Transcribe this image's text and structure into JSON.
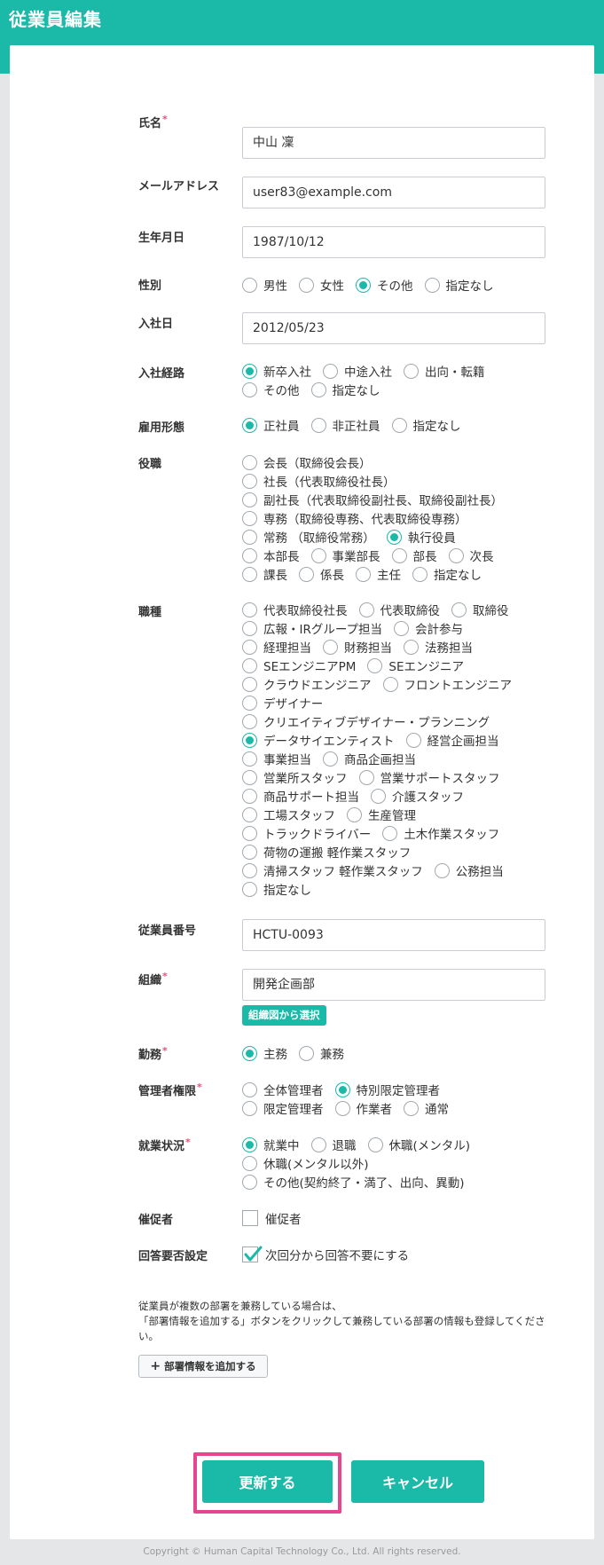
{
  "page_title": "従業員編集",
  "fields": {
    "name": {
      "label": "氏名",
      "value": "中山 凜"
    },
    "email": {
      "label": "メールアドレス",
      "value": "user83@example.com"
    },
    "birthdate": {
      "label": "生年月日",
      "value": "1987/10/12"
    },
    "gender": {
      "label": "性別",
      "options": [
        "男性",
        "女性",
        "その他",
        "指定なし"
      ],
      "selected": "その他"
    },
    "join_date": {
      "label": "入社日",
      "value": "2012/05/23"
    },
    "join_route": {
      "label": "入社経路",
      "options": [
        "新卒入社",
        "中途入社",
        "出向・転籍",
        "その他",
        "指定なし"
      ],
      "selected": "新卒入社"
    },
    "employment_type": {
      "label": "雇用形態",
      "options": [
        "正社員",
        "非正社員",
        "指定なし"
      ],
      "selected": "正社員"
    },
    "position": {
      "label": "役職",
      "options": [
        "会長（取締役会長）",
        "社長（代表取締役社長）",
        "副社長（代表取締役副社長、取締役副社長）",
        "専務（取締役専務、代表取締役専務）",
        "常務 （取締役常務）",
        "執行役員",
        "本部長",
        "事業部長",
        "部長",
        "次長",
        "課長",
        "係長",
        "主任",
        "指定なし"
      ],
      "selected": "執行役員"
    },
    "job_type": {
      "label": "職種",
      "options": [
        "代表取締役社長",
        "代表取締役",
        "取締役",
        "広報・IRグループ担当",
        "会計参与",
        "経理担当",
        "財務担当",
        "法務担当",
        "SEエンジニアPM",
        "SEエンジニア",
        "クラウドエンジニア",
        "フロントエンジニア",
        "デザイナー",
        "クリエイティブデザイナー・プランニング",
        "データサイエンティスト",
        "経営企画担当",
        "事業担当",
        "商品企画担当",
        "営業所スタッフ",
        "営業サポートスタッフ",
        "商品サポート担当",
        "介護スタッフ",
        "工場スタッフ",
        "生産管理",
        "トラックドライバー",
        "土木作業スタッフ",
        "荷物の運搬 軽作業スタッフ",
        "清掃スタッフ 軽作業スタッフ",
        "公務担当",
        "指定なし"
      ],
      "selected": "データサイエンティスト"
    },
    "employee_number": {
      "label": "従業員番号",
      "value": "HCTU-0093"
    },
    "organization": {
      "label": "組織",
      "value": "開発企画部",
      "button_label": "組織図から選択"
    },
    "work_type": {
      "label": "勤務",
      "options": [
        "主務",
        "兼務"
      ],
      "selected": "主務"
    },
    "admin_role": {
      "label": "管理者権限",
      "options": [
        "全体管理者",
        "特別限定管理者",
        "限定管理者",
        "作業者",
        "通常"
      ],
      "selected": "特別限定管理者"
    },
    "work_status": {
      "label": "就業状況",
      "options": [
        "就業中",
        "退職",
        "休職(メンタル)",
        "休職(メンタル以外)",
        "その他(契約終了・満了、出向、異動)"
      ],
      "selected": "就業中"
    },
    "promoter": {
      "label": "催促者",
      "checkbox_label": "催促者",
      "checked": false
    },
    "answer_setting": {
      "label": "回答要否設定",
      "checkbox_label": "次回分から回答不要にする",
      "checked": true
    }
  },
  "required_mark": "*",
  "note_lines": [
    "従業員が複数の部署を兼務している場合は、",
    "「部署情報を追加する」ボタンをクリックして兼務している部署の情報も登録してください。"
  ],
  "add_department_label": "部署情報を追加する",
  "update_label": "更新する",
  "cancel_label": "キャンセル",
  "footer": "Copyright © Human Capital Technology Co., Ltd. All rights reserved.",
  "accent_color": "#1ab9a8",
  "focus_color": "#e4468f"
}
